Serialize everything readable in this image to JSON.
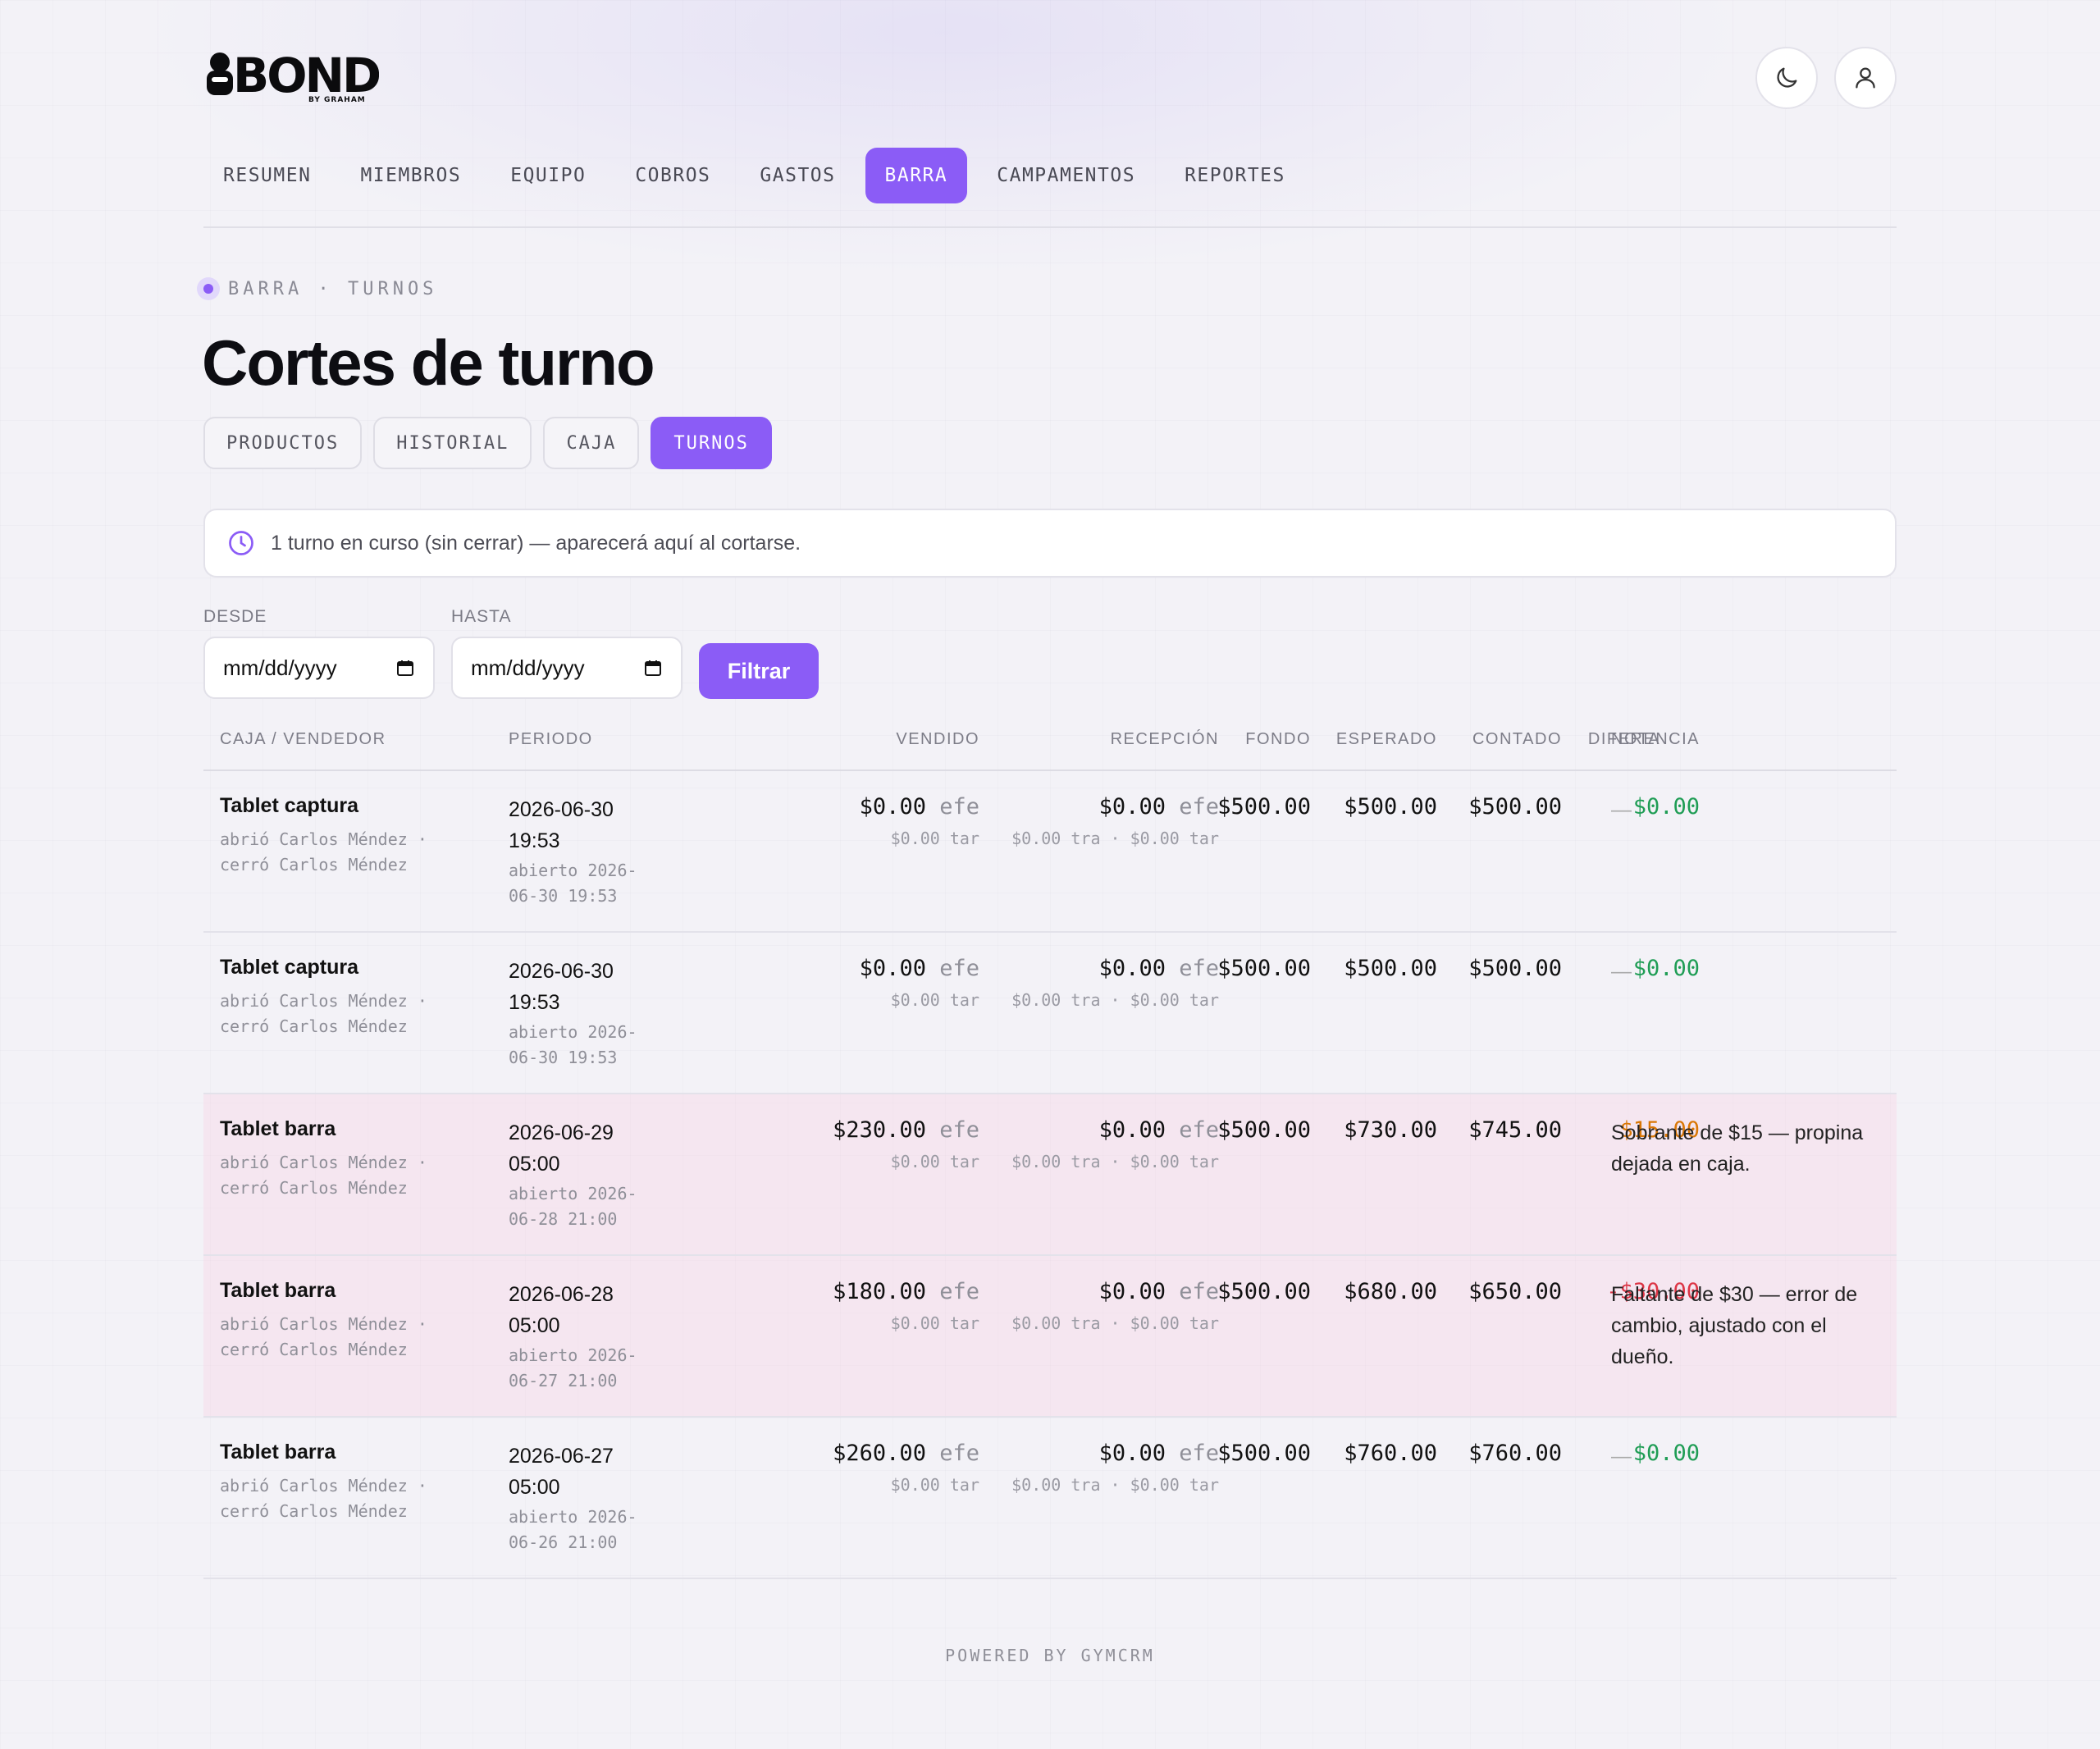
{
  "brand": {
    "logo_text": "BOND",
    "logo_sub": "BY GRAHAM"
  },
  "header": {
    "theme_icon": "moon-icon",
    "user_icon": "user-icon"
  },
  "nav": [
    "RESUMEN",
    "MIEMBROS",
    "EQUIPO",
    "COBROS",
    "GASTOS",
    "BARRA",
    "CAMPAMENTOS",
    "REPORTES"
  ],
  "nav_active": "BARRA",
  "breadcrumb": "BARRA · TURNOS",
  "page_title": "Cortes de turno",
  "subtabs": [
    "PRODUCTOS",
    "HISTORIAL",
    "CAJA",
    "TURNOS"
  ],
  "subtab_active": "TURNOS",
  "notice": {
    "icon": "clock-icon",
    "text": "1 turno en curso (sin cerrar) — aparecerá aquí al cortarse."
  },
  "filters": {
    "desde_label": "DESDE",
    "hasta_label": "HASTA",
    "desde_value": "mm/dd/yyyy",
    "hasta_value": "mm/dd/yyyy",
    "button": "Filtrar"
  },
  "table": {
    "headers": [
      "CAJA / VENDEDOR",
      "PERIODO",
      "VENDIDO",
      "RECEPCIÓN",
      "FONDO",
      "ESPERADO",
      "CONTADO",
      "DIFERENCIA",
      "NOTA"
    ],
    "rows": [
      {
        "caja": "Tablet captura",
        "sub": "abrió Carlos Méndez · cerró Carlos Méndez",
        "fecha": "2026-06-30 19:53",
        "abierto": "abierto 2026-06-30 19:53",
        "vendido": "$0.00",
        "vendido_unit": "efe",
        "vendido_tar": "$0.00 tar",
        "recepcion": "$0.00",
        "recepcion_unit": "efe",
        "recepcion_sub": "$0.00 tra · $0.00 tar",
        "fondo": "$500.00",
        "esperado": "$500.00",
        "contado": "$500.00",
        "diferencia": "$0.00",
        "diff_status": "green",
        "nota": "—",
        "tinted": false
      },
      {
        "caja": "Tablet captura",
        "sub": "abrió Carlos Méndez · cerró Carlos Méndez",
        "fecha": "2026-06-30 19:53",
        "abierto": "abierto 2026-06-30 19:53",
        "vendido": "$0.00",
        "vendido_unit": "efe",
        "vendido_tar": "$0.00 tar",
        "recepcion": "$0.00",
        "recepcion_unit": "efe",
        "recepcion_sub": "$0.00 tra · $0.00 tar",
        "fondo": "$500.00",
        "esperado": "$500.00",
        "contado": "$500.00",
        "diferencia": "$0.00",
        "diff_status": "green",
        "nota": "—",
        "tinted": false
      },
      {
        "caja": "Tablet barra",
        "sub": "abrió Carlos Méndez · cerró Carlos Méndez",
        "fecha": "2026-06-29 05:00",
        "abierto": "abierto 2026-06-28 21:00",
        "vendido": "$230.00",
        "vendido_unit": "efe",
        "vendido_tar": "$0.00 tar",
        "recepcion": "$0.00",
        "recepcion_unit": "efe",
        "recepcion_sub": "$0.00 tra · $0.00 tar",
        "fondo": "$500.00",
        "esperado": "$730.00",
        "contado": "$745.00",
        "diferencia": "$15.00",
        "diff_status": "orange",
        "nota": "Sobrante de $15 — propina dejada en caja.",
        "tinted": true
      },
      {
        "caja": "Tablet barra",
        "sub": "abrió Carlos Méndez · cerró Carlos Méndez",
        "fecha": "2026-06-28 05:00",
        "abierto": "abierto 2026-06-27 21:00",
        "vendido": "$180.00",
        "vendido_unit": "efe",
        "vendido_tar": "$0.00 tar",
        "recepcion": "$0.00",
        "recepcion_unit": "efe",
        "recepcion_sub": "$0.00 tra · $0.00 tar",
        "fondo": "$500.00",
        "esperado": "$680.00",
        "contado": "$650.00",
        "diferencia": "-$30.00",
        "diff_status": "red",
        "nota": "Faltante de $30 — error de cambio, ajustado con el dueño.",
        "tinted": true
      },
      {
        "caja": "Tablet barra",
        "sub": "abrió Carlos Méndez · cerró Carlos Méndez",
        "fecha": "2026-06-27 05:00",
        "abierto": "abierto 2026-06-26 21:00",
        "vendido": "$260.00",
        "vendido_unit": "efe",
        "vendido_tar": "$0.00 tar",
        "recepcion": "$0.00",
        "recepcion_unit": "efe",
        "recepcion_sub": "$0.00 tra · $0.00 tar",
        "fondo": "$500.00",
        "esperado": "$760.00",
        "contado": "$760.00",
        "diferencia": "$0.00",
        "diff_status": "green",
        "nota": "—",
        "tinted": false
      }
    ]
  },
  "footer": "POWERED BY GYMCRM",
  "colors": {
    "accent": "#8b5cf6",
    "positive": "#1f9d55",
    "warning": "#d97706",
    "negative": "#dc3545"
  }
}
